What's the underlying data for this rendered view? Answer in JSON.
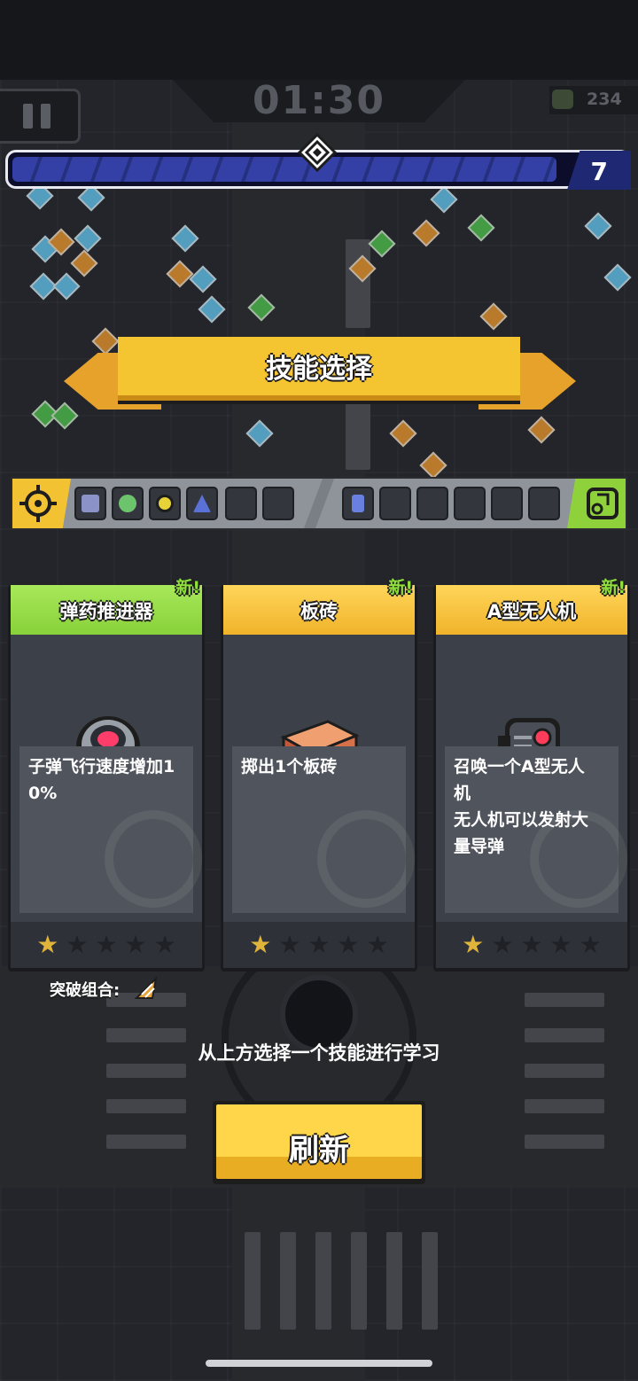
{
  "hud": {
    "timer": "01:30",
    "kill_count": "234",
    "level": "7",
    "xp_progress": 0.89
  },
  "title": "技能选择",
  "slots": {
    "active": [
      "launcher-icon",
      "ball-icon",
      "target-ring-icon",
      "cone-icon",
      "empty",
      "empty"
    ],
    "passive": [
      "battery-icon",
      "empty",
      "empty",
      "empty",
      "empty",
      "empty"
    ]
  },
  "cards": [
    {
      "name": "弹药推进器",
      "new_tag": "新!",
      "header_color": "#8fd63e",
      "icon": "ammo-thruster-icon",
      "description": "子弹飞行速度增加1\n0%",
      "stars": 1,
      "max_stars": 5
    },
    {
      "name": "板砖",
      "new_tag": "新!",
      "header_color": "#f3c232",
      "icon": "brick-icon",
      "description": "掷出1个板砖",
      "stars": 1,
      "max_stars": 5
    },
    {
      "name": "A型无人机",
      "new_tag": "新!",
      "header_color": "#f3c232",
      "icon": "drone-icon",
      "description": "召唤一个A型无人\n机\n无人机可以发射大\n量导弹",
      "stars": 1,
      "max_stars": 5
    }
  ],
  "breakthrough": {
    "label": "突破组合:",
    "icon": "drill-icon"
  },
  "hint": "从上方选择一个技能进行学习",
  "refresh_label": "刷新",
  "colors": {
    "accent_yellow": "#f5c531",
    "accent_green": "#8fd63e",
    "xp_blue": "#3540a6"
  }
}
